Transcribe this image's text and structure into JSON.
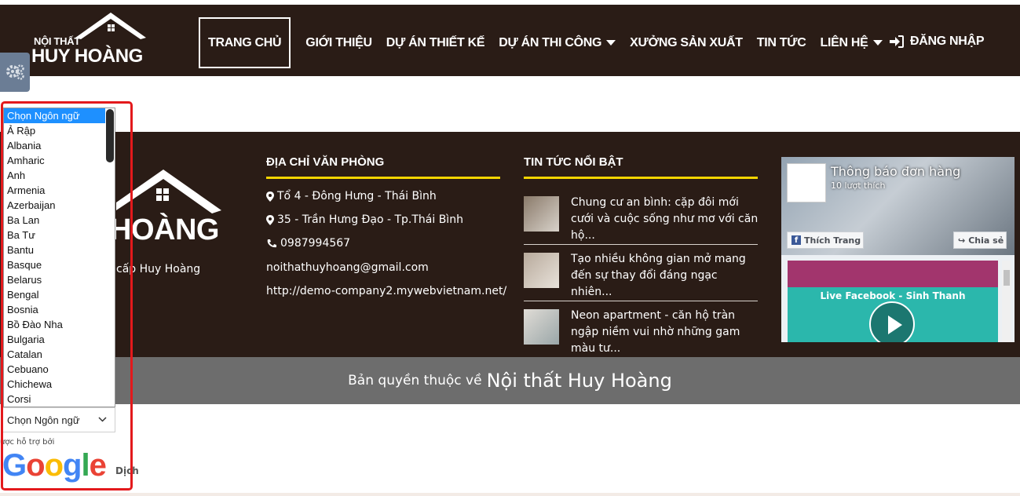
{
  "header": {
    "logo_small": "NỘI THẤT",
    "logo_big": "HUY HOÀNG",
    "nav": [
      {
        "label": "TRANG CHỦ",
        "active": true,
        "dropdown": false
      },
      {
        "label": "GIỚI THIỆU",
        "active": false,
        "dropdown": false
      },
      {
        "label": "DỰ ÁN THIẾT KẾ",
        "active": false,
        "dropdown": false
      },
      {
        "label": "DỰ ÁN THI CÔNG",
        "active": false,
        "dropdown": true
      },
      {
        "label": "XƯỞNG SẢN XUẤT",
        "active": false,
        "dropdown": false
      },
      {
        "label": "TIN TỨC",
        "active": false,
        "dropdown": false
      },
      {
        "label": "LIÊN HỆ",
        "active": false,
        "dropdown": true
      }
    ],
    "login": "ĐĂNG NHẬP"
  },
  "footer": {
    "logo_text": "HOÀNG",
    "slogan": "o cấp Huy Hoàng",
    "address_title": "ĐỊA CHỈ VĂN PHÒNG",
    "address_lines": [
      "Tổ 4 - Đông Hưng - Thái Bình",
      "35 - Trần Hưng Đạo - Tp.Thái Bình",
      "0987994567",
      "noithathuyhoang@gmail.com",
      "http://demo-company2.mywebvietnam.net/"
    ],
    "news_title": "TIN TỨC NỔI BẬT",
    "news": [
      "Chung cư an bình: cặp đôi mới cưới và cuộc sống như mơ với căn hộ...",
      "Tạo nhiều không gian mở mang đến sự thay đổi đáng ngạc nhiên...",
      "Neon apartment - căn hộ tràn ngập niềm vui nhờ những gam màu tư..."
    ],
    "facebook": {
      "page_name": "Thông báo đơn hàng",
      "likes": "10 lượt thích",
      "like_button": "Thích Trang",
      "share_button": "Chia sẻ",
      "video_title": "Live Facebook - Sinh Thanh"
    },
    "copyright_small": "Bản quyền thuộc về",
    "copyright_big": "Nội thất Huy Hoàng"
  },
  "translate": {
    "options": [
      "Chọn Ngôn ngữ",
      "Ả Rập",
      "Albania",
      "Amharic",
      "Anh",
      "Armenia",
      "Azerbaijan",
      "Ba Lan",
      "Ba Tư",
      "Bantu",
      "Basque",
      "Belarus",
      "Bengal",
      "Bosnia",
      "Bồ Đào Nha",
      "Bulgaria",
      "Catalan",
      "Cebuano",
      "Chichewa",
      "Corsi"
    ],
    "selected": "Chọn Ngôn ngữ",
    "powered_by": "ược hỗ trợ bởi",
    "google": "Google",
    "translate_word": "Dịch"
  },
  "colors": {
    "header_bg": "#2a1c16",
    "accent_underline": "#f3d500",
    "selected_option": "#1e90ff",
    "highlight_box": "#e3191c",
    "copyright_bg": "#6d6d6d"
  }
}
